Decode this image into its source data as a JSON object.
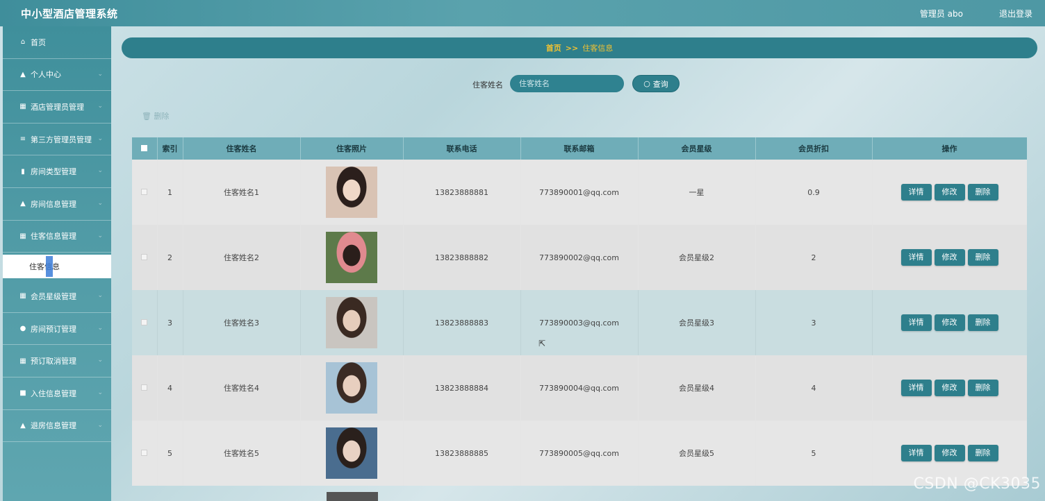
{
  "header": {
    "title": "中小型酒店管理系统",
    "user": "管理员 abo",
    "logout": "退出登录"
  },
  "sidebar": {
    "items": [
      {
        "label": "首页",
        "icon": "home-icon",
        "glyph": "⌂"
      },
      {
        "label": "个人中心",
        "icon": "user-icon",
        "glyph": "▲"
      },
      {
        "label": "酒店管理员管理",
        "icon": "list-icon",
        "glyph": "▦"
      },
      {
        "label": "第三方管理员管理",
        "icon": "menu-icon",
        "glyph": "≡"
      },
      {
        "label": "房间类型管理",
        "icon": "bar-chart-icon",
        "glyph": "▮"
      },
      {
        "label": "房间信息管理",
        "icon": "user-icon",
        "glyph": "▲"
      },
      {
        "label": "住客信息管理",
        "icon": "grid-icon",
        "glyph": "▦"
      },
      {
        "label": "会员星级管理",
        "icon": "grid-icon",
        "glyph": "▦"
      },
      {
        "label": "房间预订管理",
        "icon": "pin-icon",
        "glyph": "●"
      },
      {
        "label": "预订取消管理",
        "icon": "grid-icon",
        "glyph": "▦"
      },
      {
        "label": "入住信息管理",
        "icon": "chat-icon",
        "glyph": "■"
      },
      {
        "label": "退房信息管理",
        "icon": "user-icon",
        "glyph": "▲"
      }
    ],
    "sub_item": "住客信息"
  },
  "breadcrumb": {
    "home": "首页",
    "sep": ">>",
    "current": "住客信息"
  },
  "search": {
    "label": "住客姓名",
    "placeholder": "住客姓名",
    "button": "查询"
  },
  "toolbar": {
    "delete": "删除"
  },
  "table": {
    "headers": [
      "索引",
      "住客姓名",
      "住客照片",
      "联系电话",
      "联系邮箱",
      "会员星级",
      "会员折扣",
      "操作"
    ],
    "actions": [
      "详情",
      "修改",
      "删除"
    ],
    "rows": [
      {
        "index": "1",
        "name": "住客姓名1",
        "phone": "13823888881",
        "email": "773890001@qq.com",
        "level": "一星",
        "discount": "0.9",
        "photo_colors": [
          "#d9c3b4",
          "#2b1f1c",
          "#f0d8c8"
        ]
      },
      {
        "index": "2",
        "name": "住客姓名2",
        "phone": "13823888882",
        "email": "773890002@qq.com",
        "level": "会员星级2",
        "discount": "2",
        "photo_colors": [
          "#5d7a4a",
          "#e08a8f",
          "#2a1e1b"
        ]
      },
      {
        "index": "3",
        "name": "住客姓名3",
        "phone": "13823888883",
        "email": "773890003@qq.com",
        "level": "会员星级3",
        "discount": "3",
        "photo_colors": [
          "#c9c5c0",
          "#3a2a22",
          "#e6cdbb"
        ]
      },
      {
        "index": "4",
        "name": "住客姓名4",
        "phone": "13823888884",
        "email": "773890004@qq.com",
        "level": "会员星级4",
        "discount": "4",
        "photo_colors": [
          "#a7c3d6",
          "#3b2b24",
          "#e8cfbf"
        ]
      },
      {
        "index": "5",
        "name": "住客姓名5",
        "phone": "13823888885",
        "email": "773890005@qq.com",
        "level": "会员星级5",
        "discount": "5",
        "photo_colors": [
          "#4a6d8f",
          "#2a201c",
          "#e9d2c4"
        ]
      }
    ]
  },
  "watermark": "CSDN @CK3035"
}
